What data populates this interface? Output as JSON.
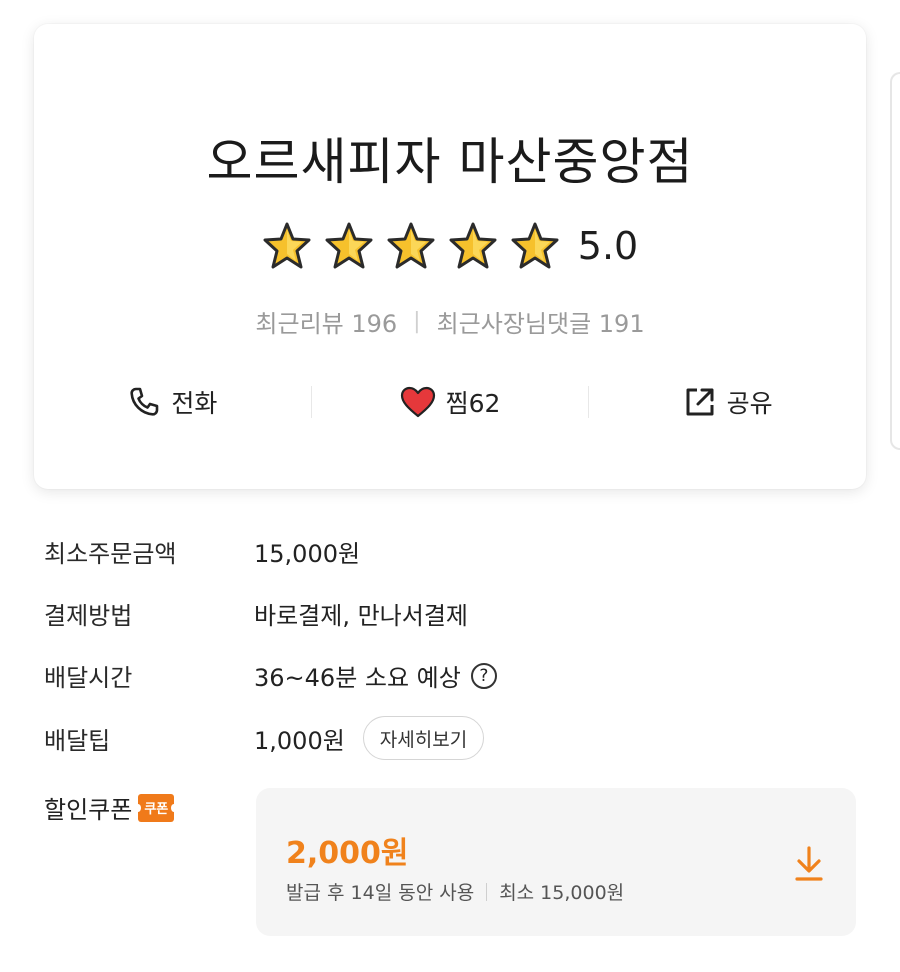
{
  "store": {
    "name": "오르새피자 마산중앙점",
    "rating": "5.0",
    "rating_stars": 5,
    "recent_reviews_label": "최근리뷰 196",
    "separator": "|",
    "owner_replies_label": "최근사장님댓글 191"
  },
  "actions": {
    "call_label": "전화",
    "like_label": "찜62",
    "share_label": "공유"
  },
  "info": {
    "min_order_label": "최소주문금액",
    "min_order_value": "15,000원",
    "payment_label": "결제방법",
    "payment_value": "바로결제, 만나서결제",
    "delivery_time_label": "배달시간",
    "delivery_time_value": "36~46분 소요 예상",
    "help_glyph": "?",
    "delivery_tip_label": "배달팁",
    "delivery_tip_value": "1,000원",
    "detail_button": "자세히보기",
    "coupon_label": "할인쿠폰",
    "coupon_badge": "쿠폰"
  },
  "coupon": {
    "amount": "2,000원",
    "validity": "발급 후 14일 동안 사용",
    "minimum": "최소 15,000원"
  },
  "colors": {
    "accent_orange": "#f0821c",
    "star_gold": "#f6c12c",
    "heart_red": "#e5383b"
  },
  "icons": {
    "call": "phone-icon",
    "like": "heart-icon",
    "share": "share-icon",
    "download": "download-icon",
    "help": "question-circle-icon",
    "star": "star-icon"
  }
}
